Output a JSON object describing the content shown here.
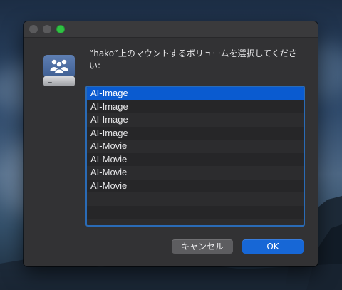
{
  "dialog": {
    "message": "“hako”上のマウントするボリュームを選択してください:",
    "volumes": [
      "AI-Image",
      "AI-Image",
      "AI-Image",
      "AI-Image",
      "AI-Movie",
      "AI-Movie",
      "AI-Movie",
      "AI-Movie"
    ],
    "selected_index": 0,
    "cancel_label": "キャンセル",
    "ok_label": "OK"
  },
  "icons": {
    "drive": "network-drive-icon"
  },
  "colors": {
    "window_bg": "#323234",
    "selection": "#0a5bd0",
    "ok_button": "#1767d6",
    "focus_ring": "#2a6bb6"
  }
}
